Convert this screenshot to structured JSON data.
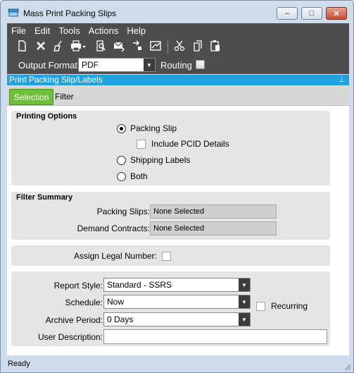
{
  "window": {
    "title": "Mass Print Packing Slips",
    "minimize_glyph": "–",
    "maximize_glyph": "□",
    "close_glyph": "✕"
  },
  "menu": {
    "items": [
      "File",
      "Edit",
      "Tools",
      "Actions",
      "Help"
    ]
  },
  "toolbar": {
    "icons": [
      "new-icon",
      "delete-icon",
      "clear-icon",
      "print-icon",
      "print-preview-icon",
      "send-email-icon",
      "attach-icon",
      "fax-icon",
      "cut-icon",
      "copy-icon",
      "paste-icon"
    ]
  },
  "output": {
    "label": "Output Format:",
    "value": "PDF",
    "routing_label": "Routing",
    "routing_checked": false
  },
  "panel": {
    "title": "Print Packing Slip/Labels"
  },
  "tabs": {
    "selection": "Selection",
    "filter": "Filter"
  },
  "printing_options": {
    "title": "Printing Options",
    "packing_slip": "Packing Slip",
    "include_pcid": "Include PCID Details",
    "shipping_labels": "Shipping Labels",
    "both": "Both",
    "selected": "packing_slip"
  },
  "filter_summary": {
    "title": "Filter Summary",
    "packing_slips_label": "Packing Slips:",
    "packing_slips_value": "None Selected",
    "demand_contracts_label": "Demand Contracts:",
    "demand_contracts_value": "None Selected"
  },
  "legal": {
    "label": "Assign Legal Number:",
    "checked": false
  },
  "report": {
    "style_label": "Report Style:",
    "style_value": "Standard - SSRS",
    "schedule_label": "Schedule:",
    "schedule_value": "Now",
    "recurring_label": "Recurring",
    "archive_label": "Archive Period:",
    "archive_value": "0 Days",
    "user_desc_label": "User Description:",
    "user_desc_value": ""
  },
  "status": {
    "text": "Ready"
  },
  "colors": {
    "window_bg": "#cfdcec",
    "dark_toolbar": "#4d4d4d",
    "panel_header": "#1fa2e1",
    "active_tab": "#6fbf3a",
    "group_bg": "#e5e5e5"
  }
}
